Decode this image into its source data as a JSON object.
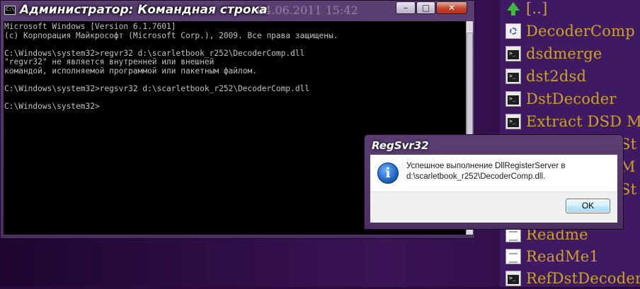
{
  "cmd_window": {
    "title": "Администратор: Командная строка",
    "clock_ghost_text": "04.06.2011 15:42",
    "min_glyph": "–",
    "max_glyph": "□",
    "close_glyph": "✕",
    "console_text": "Microsoft Windows [Version 6.1.7601]\n(c) Корпорация Майкрософт (Microsoft Corp.), 2009. Все права защищены.\n\nC:\\Windows\\system32>regvr32 d:\\scarletbook_r252\\DecoderComp.dll\n\"regvr32\" не является внутренней или внешней\nкомандой, исполняемой программой или пакетным файлом.\n\nC:\\Windows\\system32>regsvr32 d:\\scarletbook_r252\\DecoderComp.dll\n\nC:\\Windows\\system32>"
  },
  "dialog": {
    "title": "RegSvr32",
    "icon": "info-icon",
    "icon_glyph": "i",
    "message_line1": "Успешное выполнение DllRegisterServer в",
    "message_line2": "d:\\scarletbook_r252\\DecoderComp.dll.",
    "ok_label": "OK"
  },
  "file_panel": {
    "items": [
      {
        "label": "[..]",
        "icon": "up-arrow-icon"
      },
      {
        "label": "DecoderComp",
        "icon": "gear-file-icon"
      },
      {
        "label": "dsdmerge",
        "icon": "console-app-icon"
      },
      {
        "label": "dst2dsd",
        "icon": "console-app-icon"
      },
      {
        "label": "DstDecoder",
        "icon": "console-app-icon"
      },
      {
        "label": "Extract DSD M",
        "icon": "console-app-icon"
      },
      {
        "label": "St",
        "icon": "console-app-icon"
      },
      {
        "label": "M",
        "icon": "console-app-icon"
      },
      {
        "label": "St",
        "icon": "console-app-icon"
      },
      {
        "label": "Readme",
        "icon": "document-icon"
      },
      {
        "label": "ReadMe1",
        "icon": "document-icon"
      },
      {
        "label": "RefDstDecoder",
        "icon": "console-app-icon"
      }
    ]
  },
  "colors": {
    "file_label": "#c9a227",
    "console_bg": "#000000",
    "console_text": "#c0c0c0",
    "close_button": "#c4422d"
  }
}
